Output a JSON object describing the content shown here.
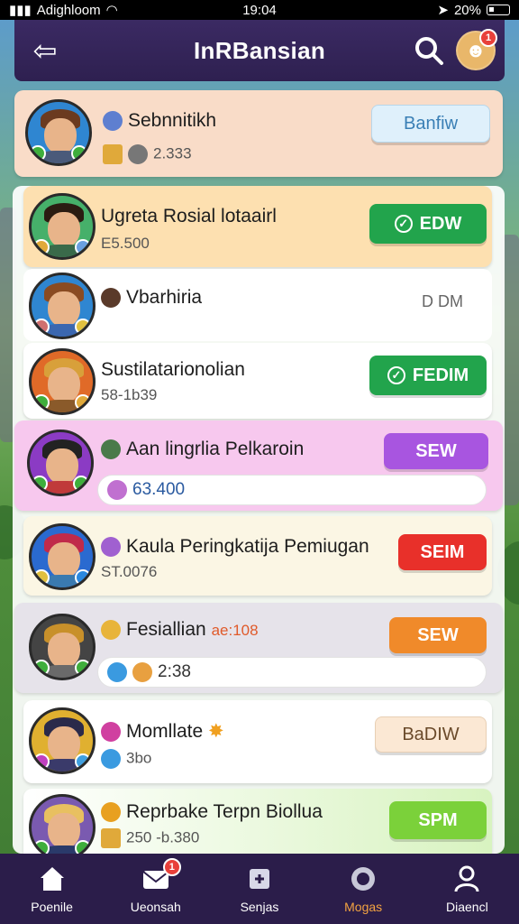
{
  "status_bar": {
    "carrier": "Adighloom",
    "time": "19:04",
    "battery": "20%"
  },
  "header": {
    "title": "InRBansian",
    "avatar_badge": "1"
  },
  "colors": {
    "header": "#2e2050",
    "green_button": "#22a44c",
    "purple_button": "#a855e0",
    "red_button": "#e8302a",
    "orange_button": "#f08a2a",
    "lime_button": "#7bd13a",
    "active_tab": "#f3a341"
  },
  "rows": [
    {
      "name": "Sebnnitikh",
      "sub": "2.333",
      "action": "Banfiw",
      "action_style": "light-blue",
      "bg": "peach"
    },
    {
      "name": "Ugreta Rosial lotaairl",
      "sub": "E5.500",
      "action": "EDW",
      "action_style": "green",
      "bg": "orange"
    },
    {
      "name": "Vbarhiria",
      "sub": "",
      "action": "D DM",
      "action_style": "text",
      "bg": "white"
    },
    {
      "name": "Sustilatarionolian",
      "sub": "58-1b39",
      "action": "FEDIM",
      "action_style": "green",
      "bg": "white"
    },
    {
      "name": "Aan lingrlia Pelkaroin",
      "sub": "63.400",
      "action": "SEW",
      "action_style": "purple",
      "bg": "pink"
    },
    {
      "name": "Kaula Peringkatija Pemiugan",
      "sub": "ST.0076",
      "action": "SEIM",
      "action_style": "red",
      "bg": "cream"
    },
    {
      "name": "Fesiallian",
      "name_extra": "ae:108",
      "sub": "2:38",
      "action": "SEW",
      "action_style": "orange",
      "bg": "grey"
    },
    {
      "name": "Momllate",
      "sub": "3bo",
      "action": "BaDIW",
      "action_style": "beige",
      "bg": "white"
    },
    {
      "name": "Reprbake Terpn Biollua",
      "sub": "250 -b.380",
      "action": "SPM",
      "action_style": "lime",
      "bg": "green"
    }
  ],
  "tabs": [
    {
      "label": "Poenile",
      "icon": "home-icon"
    },
    {
      "label": "Ueonsah",
      "icon": "mail-icon",
      "badge": "1"
    },
    {
      "label": "Senjas",
      "icon": "puzzle-icon"
    },
    {
      "label": "Mogas",
      "icon": "ring-icon",
      "active": true
    },
    {
      "label": "Diaencl",
      "icon": "profile-icon"
    }
  ]
}
